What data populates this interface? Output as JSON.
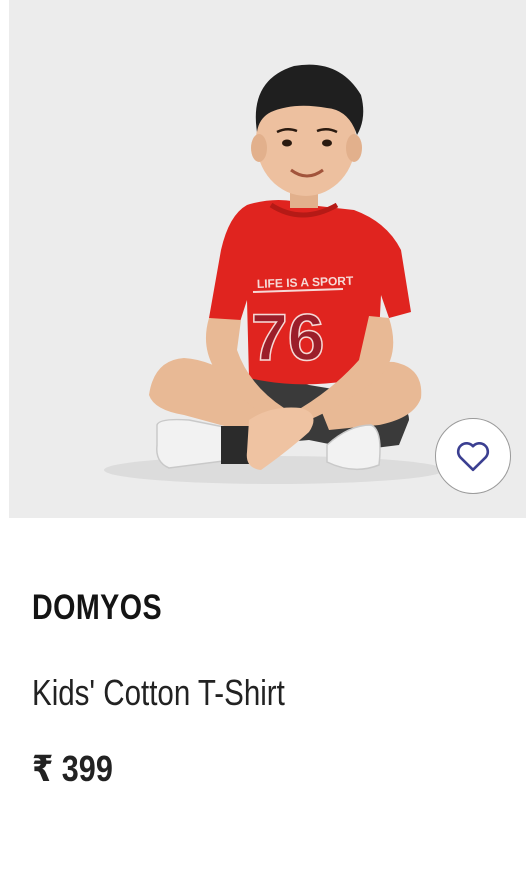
{
  "product": {
    "image_alt": "Kid sitting cross-legged wearing a red t-shirt",
    "shirt_print_line1": "LIFE IS A SPORT",
    "shirt_print_number": "76",
    "wishlist_icon": "heart-outline-icon",
    "brand": "DOMYOS",
    "name": "Kids' Cotton T-Shirt",
    "price": "₹ 399"
  },
  "colors": {
    "image_background": "#ececec",
    "shirt_red": "#e0241f",
    "heart_outline": "#3b3f91",
    "text_primary": "#141414"
  }
}
